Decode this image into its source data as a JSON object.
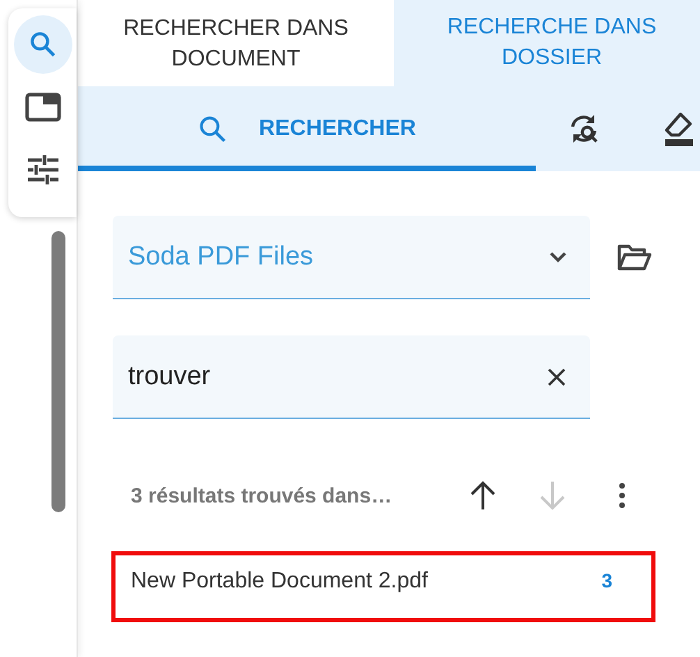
{
  "side_toolbar": [
    {
      "kind": "search",
      "selected": true
    },
    {
      "kind": "panel",
      "selected": false
    },
    {
      "kind": "sliders",
      "selected": false
    }
  ],
  "tabs": [
    {
      "label": "RECHERCHER DANS DOCUMENT",
      "selected": false
    },
    {
      "label": "RECHERCHE DANS DOSSIER",
      "selected": true
    }
  ],
  "subtabs": [
    {
      "label": "RECHERCHER",
      "selected": true
    }
  ],
  "folder_select": {
    "value": "Soda PDF Files"
  },
  "search": {
    "value": "trouver"
  },
  "results": {
    "summary": "3 résultats trouvés dans…",
    "previous_disabled": false,
    "next_disabled": true
  },
  "files": [
    {
      "name": "New Portable Document 2.pdf",
      "count": "3",
      "highlighted": true
    }
  ]
}
